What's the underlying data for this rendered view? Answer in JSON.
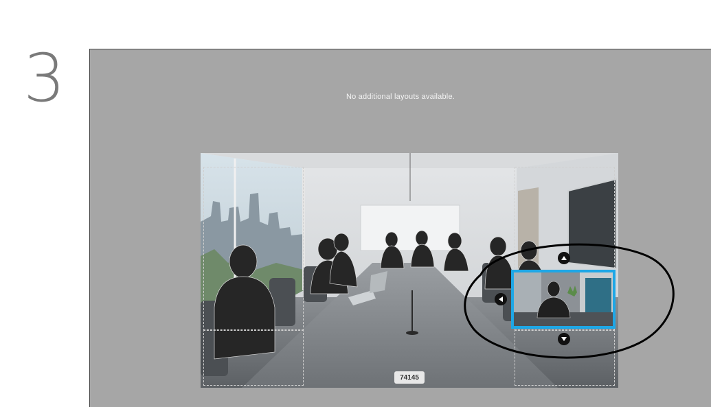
{
  "step": {
    "number": "3"
  },
  "screen": {
    "message": "No additional layouts available.",
    "call_badge": "74145"
  },
  "pip": {
    "selected": true,
    "border_color": "#1ea7e6"
  },
  "controls": {
    "up_icon": "up-arrow-icon",
    "left_icon": "left-arrow-icon",
    "down_icon": "down-arrow-icon"
  },
  "colors": {
    "screen_background": "#a6a6a6",
    "highlight": "#1ea7e6",
    "annotation": "#000000"
  }
}
